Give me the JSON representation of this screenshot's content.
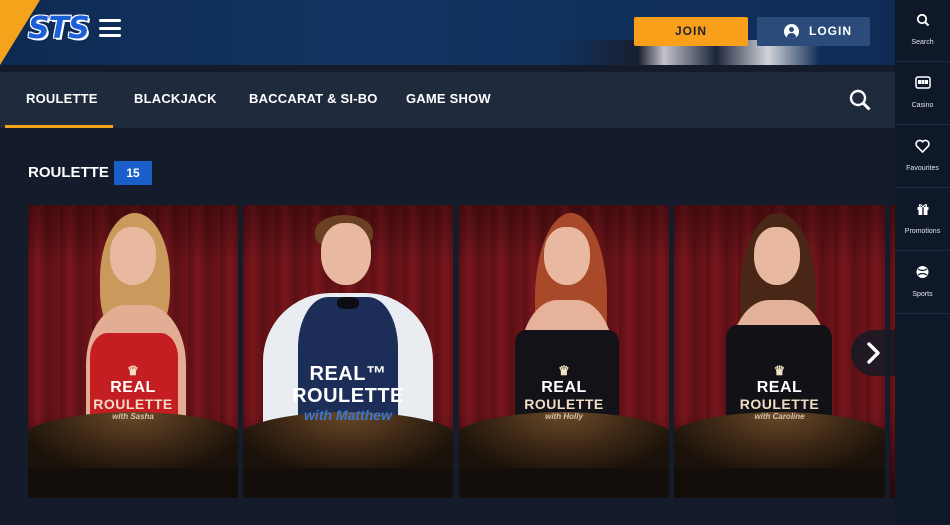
{
  "header": {
    "logo_text": "STS",
    "join_label": "JOIN",
    "login_label": "LOGIN"
  },
  "sidebar": {
    "items": [
      {
        "label": "Search",
        "icon": "search-icon"
      },
      {
        "label": "Casino",
        "icon": "slot-machine-icon"
      },
      {
        "label": "Favourites",
        "icon": "heart-icon"
      },
      {
        "label": "Promotions",
        "icon": "gift-icon"
      },
      {
        "label": "Sports",
        "icon": "ball-icon"
      }
    ]
  },
  "tabs": [
    {
      "label": "ROULETTE",
      "active": true
    },
    {
      "label": "BLACKJACK",
      "active": false
    },
    {
      "label": "BACCARAT & SI-BO",
      "active": false
    },
    {
      "label": "GAME SHOW",
      "active": false
    }
  ],
  "section": {
    "title": "ROULETTE",
    "count": "15"
  },
  "games": [
    {
      "line1": "REAL",
      "line2": "ROULETTE",
      "host": "with Sasha"
    },
    {
      "line1": "REAL™",
      "line2": "ROULETTE",
      "host": "with Matthew"
    },
    {
      "line1": "REAL",
      "line2": "ROULETTE",
      "host": "with Holly"
    },
    {
      "line1": "REAL",
      "line2": "ROULETTE",
      "host": "with Caroline"
    }
  ],
  "colors": {
    "accent": "#f5a31a",
    "brand_blue": "#1a5fc9",
    "header_bg": "#123563",
    "page_bg": "#141c2b"
  }
}
